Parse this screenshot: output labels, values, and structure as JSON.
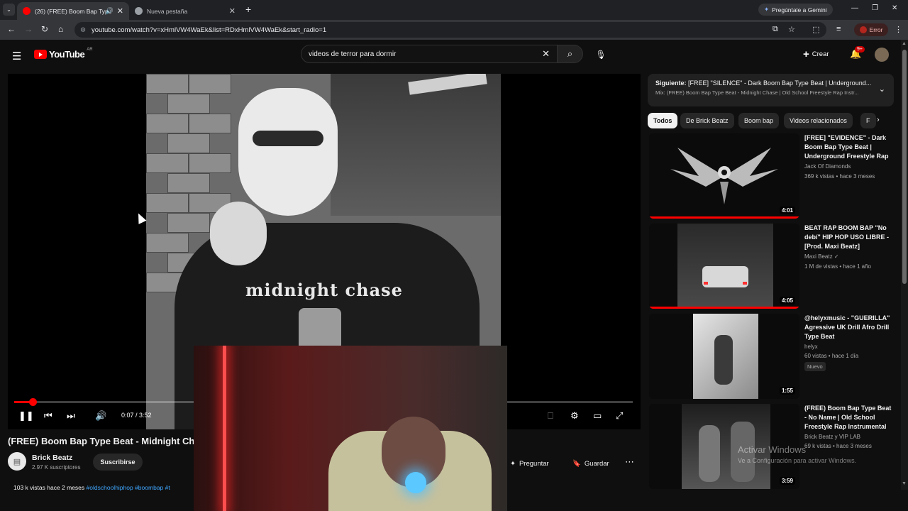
{
  "browser": {
    "tabs": [
      {
        "label": "(26) (FREE) Boom Bap Type",
        "active": true,
        "favicon_color": "#ff0000"
      },
      {
        "label": "Nueva pestaña",
        "active": false,
        "favicon_color": "#9aa0a6"
      }
    ],
    "gemini_label": "Pregúntale a Gemini",
    "url": "youtube.com/watch?v=xHmlVW4WaEk&list=RDxHmlVW4WaEk&start_radio=1",
    "error_label": "Error"
  },
  "header": {
    "logo_text": "YouTube",
    "country_code": "AR",
    "search_value": "videos de terror para dormir",
    "create_label": "Crear",
    "notif_count": "9+"
  },
  "player": {
    "time_display": "0:07 / 3:52",
    "progress_fraction": 0.03,
    "shirt_print": "midnight chase"
  },
  "video": {
    "title": "(FREE) Boom Bap Type Beat - Midnight Chase",
    "channel_name": "Brick Beatz",
    "subscribers": "2.97 K suscriptores",
    "subscribe_label": "Suscribirse",
    "desc_stats": "103 k vistas  hace 2 meses",
    "desc_tags": "#oldschoolhiphop #boombap #t",
    "ask_label": "Preguntar",
    "save_label": "Guardar"
  },
  "next_up": {
    "prefix": "Siguiente:",
    "title": "[FREE] \"SILENCE\" - Dark Boom Bap Type Beat | Underground...",
    "mix": "Mix: (FREE) Boom Bap Type Beat - Midnight Chase | Old School Freestyle Rap Instr..."
  },
  "chips": [
    "Todos",
    "De Brick Beatz",
    "Boom bap",
    "Videos relacionados",
    "F"
  ],
  "recommendations": [
    {
      "title": "[FREE] \"EVIDENCE\" - Dark Boom Bap Type Beat | Underground Freestyle Rap ...",
      "channel": "Jack Of Diamonds",
      "meta": "369 k vistas • hace 3 meses",
      "duration": "4:01",
      "badge": "",
      "watched": true
    },
    {
      "title": "BEAT RAP BOOM BAP \"No debí\" HIP HOP USO LIBRE - [Prod. Maxi Beatz]",
      "channel": "Maxi Beatz",
      "verified": "✓",
      "meta": "1 M de vistas • hace 1 año",
      "duration": "4:05",
      "badge": "",
      "watched": true
    },
    {
      "title": "@helyxmusic - \"GUERILLA\" Agressive UK Drill Afro Drill Type Beat",
      "channel": "helyx",
      "meta": "60 vistas • hace 1 día",
      "duration": "1:55",
      "badge": "Nuevo",
      "watched": false
    },
    {
      "title": "(FREE) Boom Bap Type Beat - No Name | Old School Freestyle Rap Instrumental",
      "channel": "Brick Beatz y VIP LAB",
      "meta": "69 k vistas • hace 3 meses",
      "duration": "3:59",
      "badge": "",
      "watched": false
    }
  ],
  "windows_watermark": {
    "line1": "Activar Windows",
    "line2": "Ve a Configuración para activar Windows."
  }
}
